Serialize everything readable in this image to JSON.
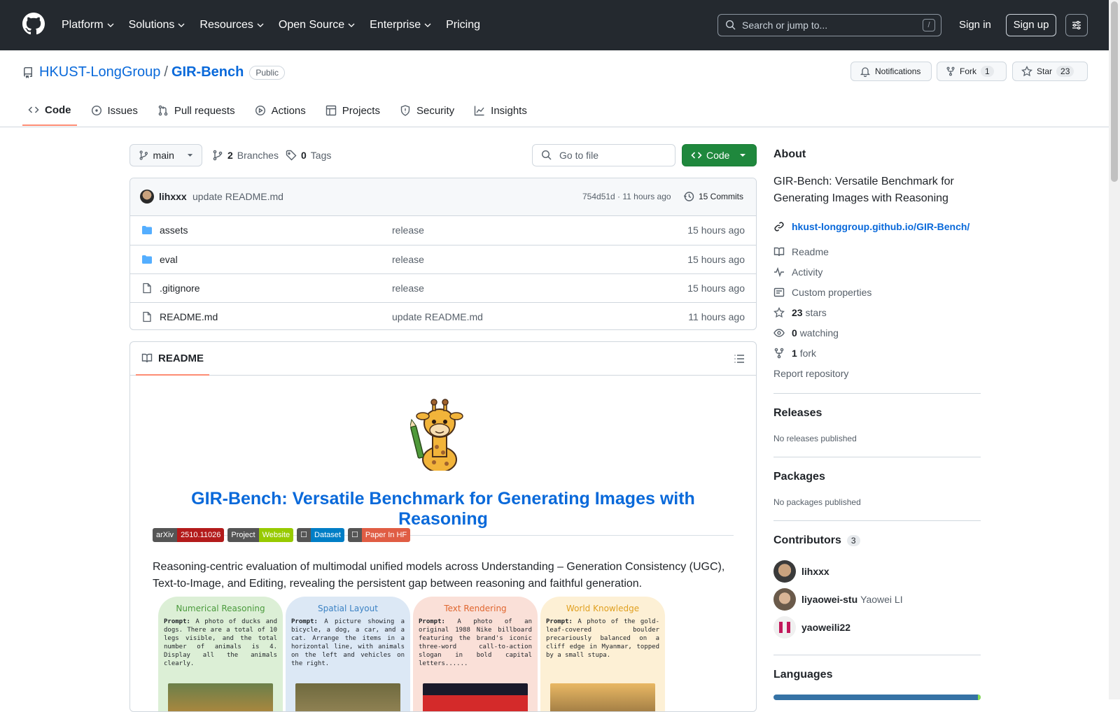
{
  "header": {
    "nav": [
      "Platform",
      "Solutions",
      "Resources",
      "Open Source",
      "Enterprise",
      "Pricing"
    ],
    "search_placeholder": "Search or jump to...",
    "search_key": "/",
    "signin": "Sign in",
    "signup": "Sign up"
  },
  "repo": {
    "owner": "HKUST-LongGroup",
    "separator": "/",
    "name": "GIR-Bench",
    "visibility": "Public",
    "notifications": "Notifications",
    "fork_label": "Fork",
    "fork_count": "1",
    "star_label": "Star",
    "star_count": "23",
    "tabs": [
      "Code",
      "Issues",
      "Pull requests",
      "Actions",
      "Projects",
      "Security",
      "Insights"
    ]
  },
  "toolbar": {
    "branch": "main",
    "branches_count": "2",
    "branches_label": "Branches",
    "tags_count": "0",
    "tags_label": "Tags",
    "goto_placeholder": "Go to file",
    "code_button": "Code"
  },
  "commit": {
    "author": "lihxxx",
    "message": "update README.md",
    "meta": "754d51d · 11 hours ago",
    "commits": "15 Commits"
  },
  "files": [
    {
      "name": "assets",
      "type": "folder",
      "message": "release",
      "time": "15 hours ago"
    },
    {
      "name": "eval",
      "type": "folder",
      "message": "release",
      "time": "15 hours ago"
    },
    {
      "name": ".gitignore",
      "type": "file",
      "message": "release",
      "time": "15 hours ago"
    },
    {
      "name": "README.md",
      "type": "file",
      "message": "update README.md",
      "time": "11 hours ago"
    }
  ],
  "readme": {
    "tab": "README",
    "title": "GIR-Bench: Versatile Benchmark for Generating Images with Reasoning",
    "badges": [
      {
        "left": "arXiv",
        "right": "2510.11026",
        "color": "#b31b1b"
      },
      {
        "left": "Project",
        "right": "Website",
        "color": "#97ca00"
      },
      {
        "left": "☐",
        "right": "Dataset",
        "color": "#007ec6"
      },
      {
        "left": "☐",
        "right": "Paper In HF",
        "color": "#e05d44"
      }
    ],
    "text": "Reasoning-centric evaluation of multimodal unified models across Understanding – Generation Consistency (UGC), Text-to-Image, and Editing, revealing the persistent gap between reasoning and faithful generation.",
    "cards": [
      {
        "title": "Numerical Reasoning",
        "prompt_label": "Prompt:",
        "prompt": "A photo of ducks and dogs. There are a total of 10 legs visible, and the total number of animals is 4. Display all the animals clearly.",
        "bg": "#dcefd6",
        "color": "#4a9a3c"
      },
      {
        "title": "Spatial Layout",
        "prompt_label": "Prompt:",
        "prompt": "A picture showing a bicycle, a dog, a car, and a cat. Arrange the items in a horizontal line, with animals on the left and vehicles on the right.",
        "bg": "#dce8f5",
        "color": "#3b82c4"
      },
      {
        "title": "Text Rendering",
        "prompt_label": "Prompt:",
        "prompt": "A photo of an original 1988 Nike billboard featuring the brand's iconic three-word call-to-action slogan in bold capital letters......",
        "bg": "#fae0d8",
        "color": "#e0662f"
      },
      {
        "title": "World Knowledge",
        "prompt_label": "Prompt:",
        "prompt": "A photo of the gold-leaf-covered boulder precariously balanced on a cliff edge in Myanmar, topped by a small stupa.",
        "bg": "#fdf0d5",
        "color": "#e0a020"
      }
    ]
  },
  "about": {
    "heading": "About",
    "description": "GIR-Bench: Versatile Benchmark for Generating Images with Reasoning",
    "link": "hkust-longgroup.github.io/GIR-Bench/",
    "readme": "Readme",
    "activity": "Activity",
    "custom": "Custom properties",
    "stars_num": "23",
    "stars_label": "stars",
    "watching_num": "0",
    "watching_label": "watching",
    "fork_num": "1",
    "fork_label": "fork",
    "report": "Report repository"
  },
  "releases": {
    "heading": "Releases",
    "text": "No releases published"
  },
  "packages": {
    "heading": "Packages",
    "text": "No packages published"
  },
  "contributors": {
    "heading": "Contributors",
    "count": "3",
    "list": [
      {
        "login": "lihxxx",
        "name": ""
      },
      {
        "login": "liyaowei-stu",
        "name": "Yaowei LI"
      },
      {
        "login": "yaoweili22",
        "name": ""
      }
    ]
  },
  "languages": {
    "heading": "Languages"
  }
}
